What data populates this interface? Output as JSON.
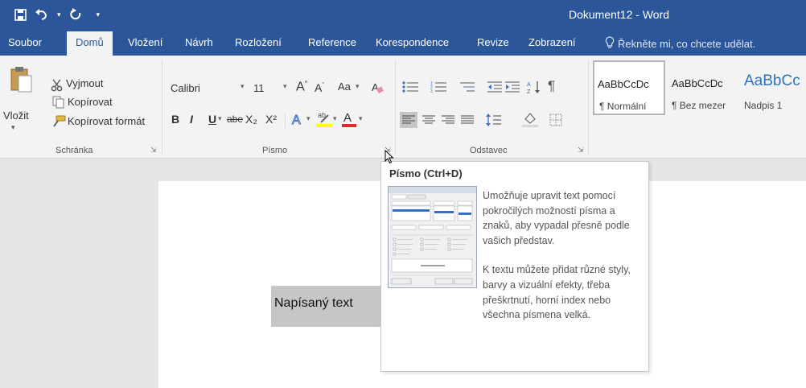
{
  "titlebar": {
    "doc_title": "Dokument12  -  Word",
    "save_icon": "save-icon",
    "undo_icon": "undo-icon",
    "redo_icon": "redo-icon",
    "customize_icon": "customize-qat-icon"
  },
  "tabs": [
    {
      "label": "Soubor"
    },
    {
      "label": "Domů"
    },
    {
      "label": "Vložení"
    },
    {
      "label": "Návrh"
    },
    {
      "label": "Rozložení"
    },
    {
      "label": "Reference"
    },
    {
      "label": "Korespondence"
    },
    {
      "label": "Revize"
    },
    {
      "label": "Zobrazení"
    }
  ],
  "tell_me": "Řekněte mi, co chcete udělat.",
  "clipboard": {
    "paste_label": "Vložit",
    "cut_label": "Vyjmout",
    "copy_label": "Kopírovat",
    "format_painter_label": "Kopírovat formát",
    "group_label": "Schránka"
  },
  "font": {
    "font_name": "Calibri",
    "font_size": "11",
    "case_label": "Aa",
    "bold": "B",
    "italic": "I",
    "underline": "U",
    "strike": "abe",
    "subscript": "X₂",
    "superscript": "X²",
    "group_label": "Písmo"
  },
  "paragraph": {
    "group_label": "Odstavec",
    "show_marks": "¶"
  },
  "styles": [
    {
      "sample": "AaBbCcDc",
      "name": "¶ Normální"
    },
    {
      "sample": "AaBbCcDc",
      "name": "¶ Bez mezer"
    },
    {
      "sample": "AaBbCc",
      "name": "Nadpis 1"
    }
  ],
  "document": {
    "text": "Napísaný text"
  },
  "tooltip": {
    "title": "Písmo (Ctrl+D)",
    "para1": "Umožňuje upravit text pomocí pokročilých možností písma a znaků, aby vypadal přesně podle vašich představ.",
    "para2": "K textu můžete přidat různé styly, barvy a vizuální efekty, třeba přeškrtnutí, horní index nebo všechna písmena velká."
  },
  "colors": {
    "brand": "#2b579a",
    "ribbon": "#f3f3f3",
    "highlight": "#ffff00",
    "font_color": "#e02b2b"
  }
}
